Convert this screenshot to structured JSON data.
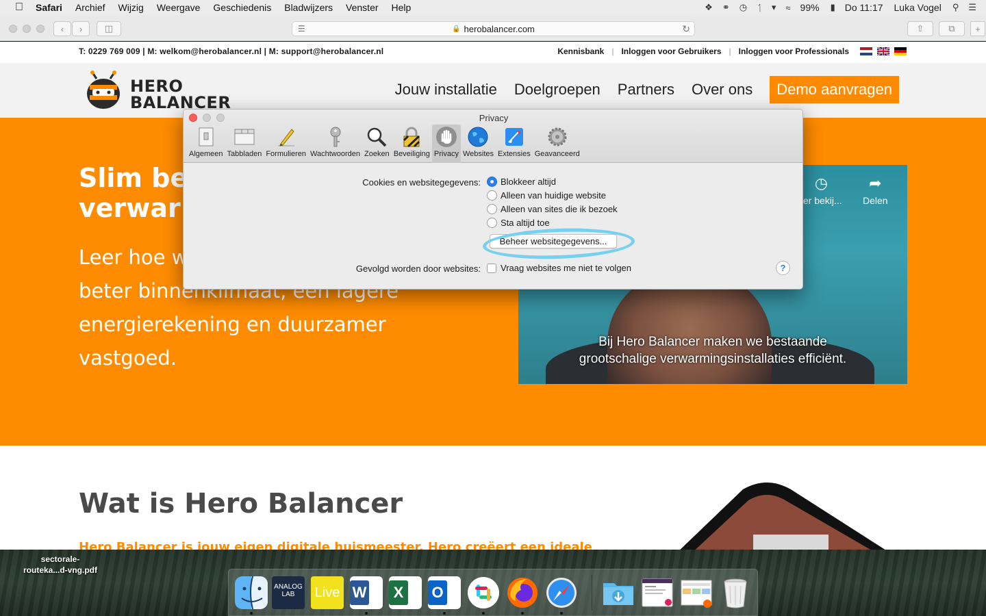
{
  "menubar": {
    "app": "Safari",
    "items": [
      "Archief",
      "Wijzig",
      "Weergave",
      "Geschiedenis",
      "Bladwijzers",
      "Venster",
      "Help"
    ],
    "battery": "99%",
    "clock": "Do 11:17",
    "user": "Luka Vogel"
  },
  "browser": {
    "url": "herobalancer.com"
  },
  "site": {
    "contact": "T: 0229 769 009 | M: welkom@herobalancer.nl | M: support@herobalancer.nl",
    "toplinks": [
      "Kennisbank",
      "Inloggen voor Gebruikers",
      "Inloggen voor Professionals"
    ],
    "logo_line1": "HERO",
    "logo_line2": "BALANCER",
    "nav": [
      "Jouw installatie",
      "Doelgroepen",
      "Partners",
      "Over ons"
    ],
    "cta": "Demo aanvragen",
    "hero_title_1": "Slim be",
    "hero_title_2": "verwar",
    "hero_text_1": "Leer hoe w",
    "hero_text_2": "beter binnenklimaat, een lagere",
    "hero_text_3": "energierekening en duurzamer",
    "hero_text_4": "vastgoed.",
    "video_watch_later": "ter bekij...",
    "video_share": "Delen",
    "video_sub_1": "Bij Hero Balancer maken we bestaande",
    "video_sub_2": "grootschalige verwarmingsinstallaties efficiënt.",
    "section_title": "Wat is Hero Balancer",
    "section_lead": "Hero Balancer is jouw eigen digitale huismeester. Hero creëert een ideale"
  },
  "dialog": {
    "title": "Privacy",
    "tabs": [
      {
        "label": "Algemeen",
        "icon": "general-icon"
      },
      {
        "label": "Tabbladen",
        "icon": "tabs-icon"
      },
      {
        "label": "Formulieren",
        "icon": "pencil-icon"
      },
      {
        "label": "Wachtwoorden",
        "icon": "key-icon"
      },
      {
        "label": "Zoeken",
        "icon": "magnifier-icon"
      },
      {
        "label": "Beveiliging",
        "icon": "padlock-icon"
      },
      {
        "label": "Privacy",
        "icon": "hand-icon"
      },
      {
        "label": "Websites",
        "icon": "globe-icon"
      },
      {
        "label": "Extensies",
        "icon": "puzzle-icon"
      },
      {
        "label": "Geavanceerd",
        "icon": "gear-icon"
      }
    ],
    "selected_tab": "Privacy",
    "cookies_label": "Cookies en websitegegevens:",
    "cookie_options": [
      "Blokkeer altijd",
      "Alleen van huidige website",
      "Alleen van sites die ik bezoek",
      "Sta altijd toe"
    ],
    "cookie_selected": "Blokkeer altijd",
    "manage_button": "Beheer websitegegevens...",
    "tracking_label": "Gevolgd worden door websites:",
    "tracking_option": "Vraag websites me niet te volgen",
    "tracking_checked": false,
    "help": "?"
  },
  "desktop": {
    "file_label_1": "sectorale-",
    "file_label_2": "routeka...d-vng.pdf"
  },
  "dock": {
    "apps": [
      "finder-icon",
      "analog-lab-icon",
      "live-icon",
      "word-icon",
      "excel-icon",
      "outlook-icon",
      "slack-icon",
      "firefox-icon",
      "safari-icon",
      "downloads-folder-icon",
      "stack-icon",
      "stack-icon-2",
      "trash-icon"
    ],
    "analog_label_1": "ANALOG",
    "analog_label_2": "LAB",
    "live_label": "Live",
    "word_letter": "W",
    "excel_letter": "X",
    "outlook_letter": "O"
  },
  "colors": {
    "brand_orange": "#ff8c00",
    "annotation_blue": "#76d0f0",
    "selection_blue": "#2a7ff2"
  }
}
